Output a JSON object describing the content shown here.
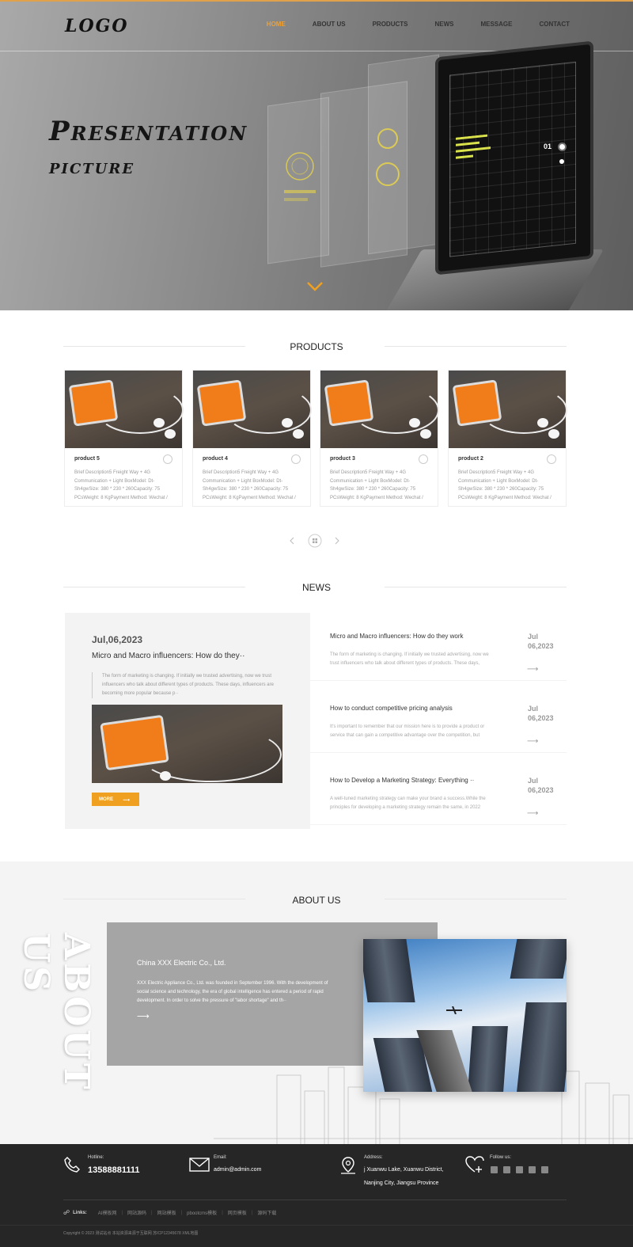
{
  "header": {
    "logo": "LOGO",
    "nav": [
      "HOME",
      "ABOUT US",
      "PRODUCTS",
      "NEWS",
      "MESSAGE",
      "CONTACT"
    ],
    "active_nav": "HOME"
  },
  "hero": {
    "title_line1": "Presentation",
    "title_line2": "picture",
    "slide_number": "01"
  },
  "products": {
    "section_title": "PRODUCTS",
    "items": [
      {
        "name": "product 5",
        "desc": "Brief Description5 Freight Way + 4G Communication + Light BoxModel: Dt-Sh4gwSize: 380 * 230 * 260Capacity: 75 PCsWeight: 8 KgPayment Method: Wechat /"
      },
      {
        "name": "product 4",
        "desc": "Brief Description5 Freight Way + 4G Communication + Light BoxModel: Dt-Sh4gwSize: 380 * 230 * 260Capacity: 75 PCsWeight: 8 KgPayment Method: Wechat /"
      },
      {
        "name": "product 3",
        "desc": "Brief Description5 Freight Way + 4G Communication + Light BoxModel: Dt-Sh4gwSize: 380 * 230 * 260Capacity: 75 PCsWeight: 8 KgPayment Method: Wechat /"
      },
      {
        "name": "product 2",
        "desc": "Brief Description5 Freight Way + 4G Communication + Light BoxModel: Dt-Sh4gwSize: 380 * 230 * 260Capacity: 75 PCsWeight: 8 KgPayment Method: Wechat /"
      }
    ]
  },
  "news": {
    "section_title": "NEWS",
    "featured": {
      "date": "Jul,06,2023",
      "title": "Micro and Macro influencers: How do they··",
      "desc": "The form of marketing is changing. If initially we trusted advertising, now we trust influencers who talk about different types of products. These days, influencers are becoming more popular because p··",
      "more_label": "MORE"
    },
    "items": [
      {
        "title": "Micro and Macro influencers: How do they work",
        "desc": "The form of marketing is changing. If initially we trusted advertising, now we trust influencers who talk about different types of products. These days,",
        "month": "Jul",
        "daydate": "06,2023"
      },
      {
        "title": "How to conduct competitive pricing analysis",
        "desc": "It's important to remember that our mission here is to provide a product or service that can gain a competitive advantage over the competition, but",
        "month": "Jul",
        "daydate": "06,2023"
      },
      {
        "title": "How to Develop a Marketing Strategy: Everything ··",
        "desc": "A well-tuned marketing strategy can make your brand a success.While the principles for developing a marketing strategy remain the same, in 2022",
        "month": "Jul",
        "daydate": "06,2023"
      }
    ]
  },
  "about": {
    "section_title": "ABOUT US",
    "vertical_text": "ABOUT US",
    "company": "China XXX Electric Co., Ltd.",
    "desc": "XXX Electric Appliance Co., Ltd. was founded in September 1996. With the development of social science and technology, the era of global intelligence has entered a period of rapid development. In order to solve the pressure of \"labor shortage\" and th··"
  },
  "footer": {
    "hotline_label": "Hotline:",
    "hotline": "13588881111",
    "email_label": "Email:",
    "email": "admin@admin.com",
    "address_label": "Address:",
    "address_line1": "j Xuanwu Lake, Xuanwu District,",
    "address_line2": "Nanjing City, Jiangsu Province",
    "follow_label": "Follow us:",
    "links_label": "Links:",
    "links": [
      "AI模板网",
      "网站源码",
      "网站模板",
      "pbootcms模板",
      "网页模板",
      "源码下载"
    ],
    "copyright": "Copyright © 2023 测试站点 本站资源来源于互联网 苏ICP12345678 XML地图"
  },
  "colors": {
    "accent": "#f0a030",
    "footer_bg": "#262626",
    "about_box": "#a5a5a5"
  }
}
